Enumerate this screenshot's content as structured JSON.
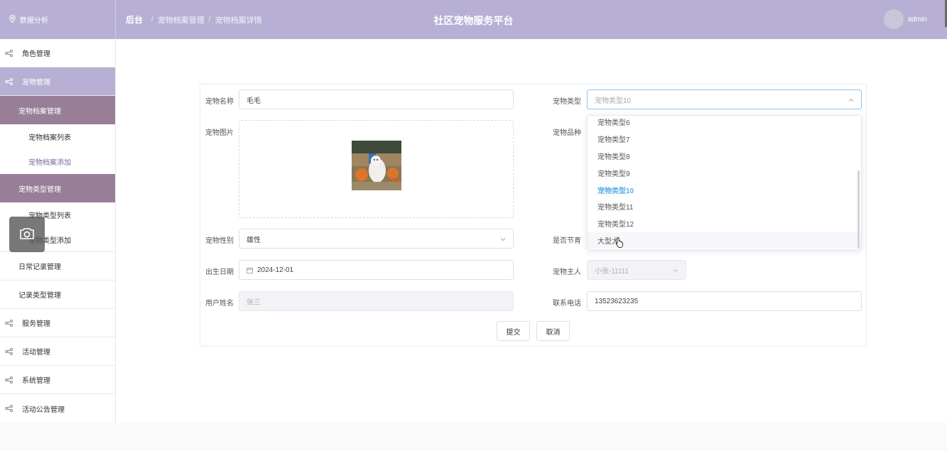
{
  "header": {
    "brand_label": "数据分析",
    "breadcrumb": [
      "后台",
      "宠物档案管理",
      "宠物档案详情"
    ],
    "app_title": "社区宠物服务平台",
    "username": "admin"
  },
  "sidebar": {
    "role": "角色管理",
    "pet": "宠物管理",
    "archive_head": "宠物档案管理",
    "archive_list": "宠物档案列表",
    "archive_add": "宠物档案添加",
    "type_head": "宠物类型管理",
    "type_list": "宠物类型列表",
    "type_add": "宠物类型添加",
    "daily": "日常记录管理",
    "record_type": "记录类型管理",
    "service": "服务管理",
    "activity": "活动管理",
    "system": "系统管理",
    "notice": "活动公告管理"
  },
  "form": {
    "name_label": "宠物名称",
    "name_value": "毛毛",
    "type_label": "宠物类型",
    "type_value": "宠物类型10",
    "image_label": "宠物图片",
    "breed_label": "宠物品种",
    "gender_label": "宠物性别",
    "gender_value": "雄性",
    "neuter_label": "是否节育",
    "birth_label": "出生日期",
    "birth_value": "2024-12-01",
    "owner_label": "宠物主人",
    "owner_value": "小张-11111",
    "user_label": "用户姓名",
    "user_value": "张三",
    "phone_label": "联系电话",
    "phone_value": "13523623235",
    "submit": "提交",
    "cancel": "取消"
  },
  "dropdown": {
    "options": [
      "宠物类型6",
      "宠物类型7",
      "宠物类型8",
      "宠物类型9",
      "宠物类型10",
      "宠物类型11",
      "宠物类型12",
      "大型犬"
    ],
    "selected": "宠物类型10",
    "hovered": "大型犬"
  },
  "colors": {
    "header": "#b7b0d4",
    "submenu": "#987e97",
    "selected_option": "#5aaee8"
  }
}
